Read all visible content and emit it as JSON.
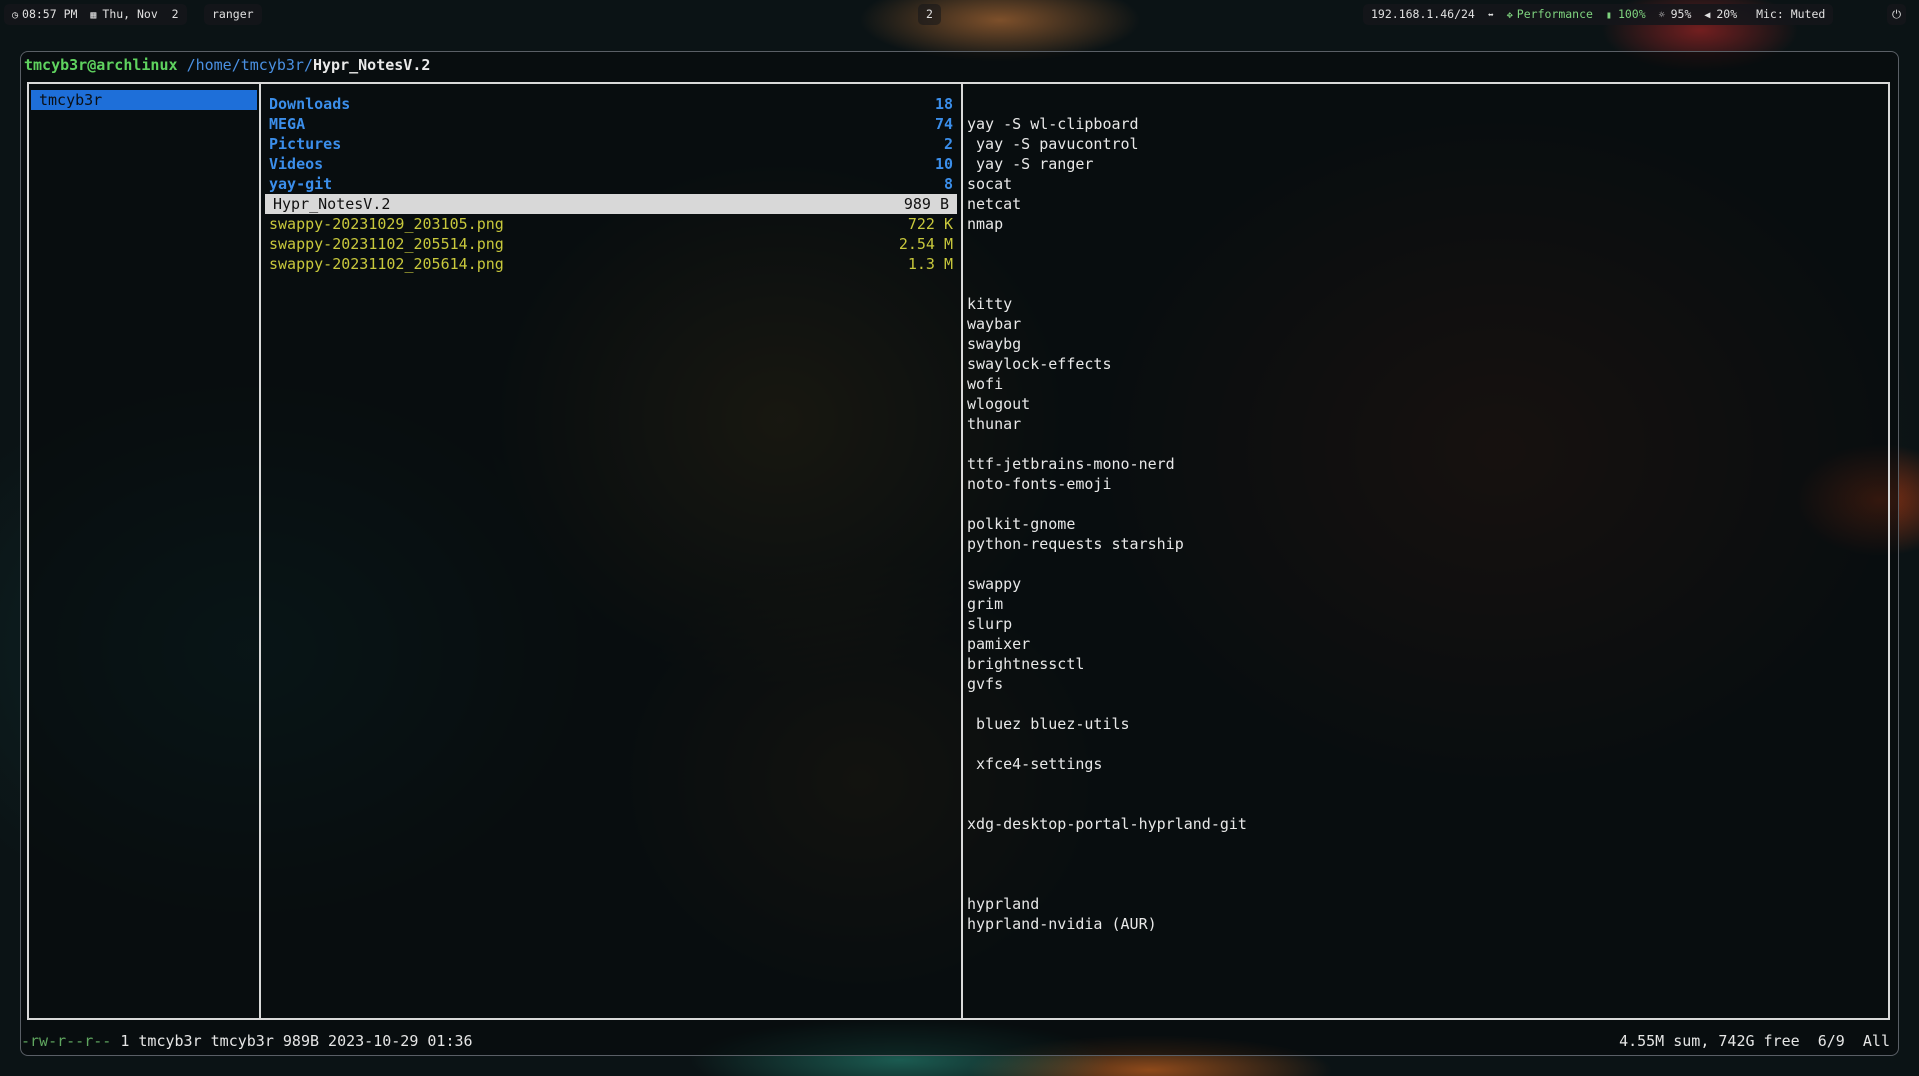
{
  "topbar": {
    "clock": "08:57 PM",
    "date": "Thu, Nov  2",
    "window_title": "ranger",
    "workspace": "2",
    "network": "192.168.1.46/24",
    "power_profile": "Performance",
    "battery": "100%",
    "brightness": "95%",
    "volume": "20%",
    "mic": "Mic: Muted",
    "icons": [
      "clock-icon",
      "calendar-icon",
      "network-icon",
      "power-profile-icon",
      "battery-icon",
      "brightness-icon",
      "volume-icon",
      "power-button-icon"
    ]
  },
  "terminal": {
    "prompt_user": "tmcyb3r@archlinux",
    "prompt_path": "/home/tmcyb3r/",
    "prompt_cwd": "Hypr_NotesV.2",
    "parent_column": [
      {
        "name": "tmcyb3r",
        "selected": true
      }
    ],
    "files": [
      {
        "name": "Downloads",
        "size": "18",
        "type": "dir"
      },
      {
        "name": "MEGA",
        "size": "74",
        "type": "dir"
      },
      {
        "name": "Pictures",
        "size": "2",
        "type": "dir"
      },
      {
        "name": "Videos",
        "size": "10",
        "type": "dir"
      },
      {
        "name": "yay-git",
        "size": "8",
        "type": "dir"
      },
      {
        "name": "Hypr_NotesV.2",
        "size": "989 B",
        "type": "file",
        "selected": true
      },
      {
        "name": "swappy-20231029_203105.png",
        "size": "722 K",
        "type": "png"
      },
      {
        "name": "swappy-20231102_205514.png",
        "size": "2.54 M",
        "type": "png"
      },
      {
        "name": "swappy-20231102_205614.png",
        "size": "1.3 M",
        "type": "png"
      }
    ],
    "preview_lines": [
      "",
      "yay -S wl-clipboard",
      " yay -S pavucontrol",
      " yay -S ranger",
      "socat",
      "netcat",
      "nmap",
      "",
      "",
      "",
      "kitty",
      "waybar",
      "swaybg",
      "swaylock-effects",
      "wofi",
      "wlogout",
      "thunar",
      "",
      "ttf-jetbrains-mono-nerd",
      "noto-fonts-emoji",
      "",
      "polkit-gnome",
      "python-requests starship",
      "",
      "swappy",
      "grim",
      "slurp",
      "pamixer",
      "brightnessctl",
      "gvfs",
      "",
      " bluez bluez-utils",
      "",
      " xfce4-settings",
      "",
      "",
      "xdg-desktop-portal-hyprland-git",
      "",
      "",
      "",
      "hyprland",
      "hyprland-nvidia (AUR)"
    ],
    "status": {
      "permissions": "-rw-r--r--",
      "info": " 1 tmcyb3r tmcyb3r 989B 2023-10-29 01:36",
      "summary": "4.55M sum, 742G free  6/9  All"
    }
  },
  "colors": {
    "dir": "#3b8eea",
    "png": "#c8c83c",
    "user": "#5fd35f",
    "selection_parent": "#1e6fd9",
    "selection_file": "#d8d8d8"
  }
}
